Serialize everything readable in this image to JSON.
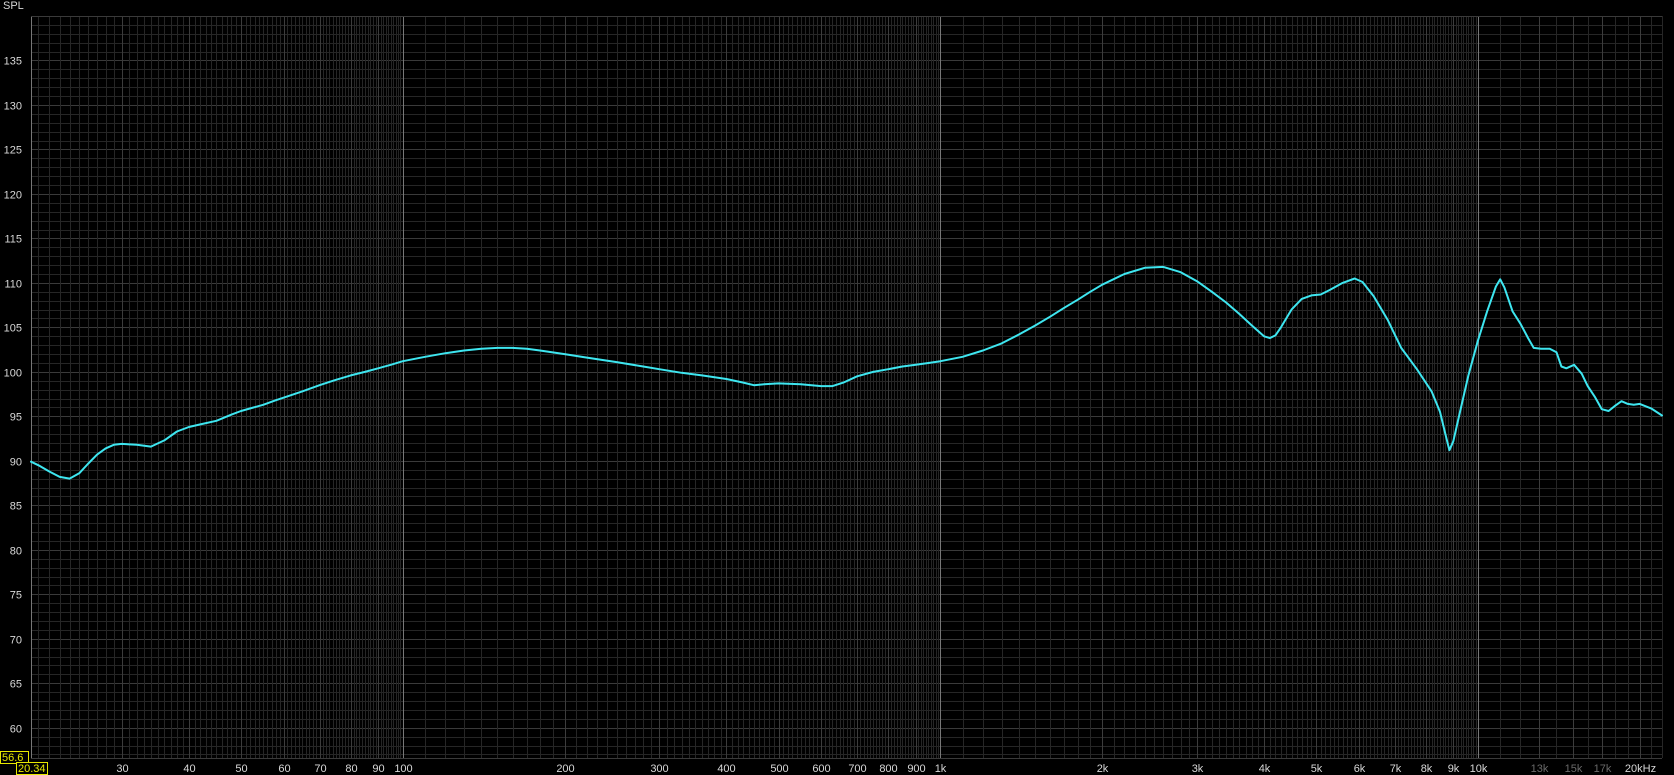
{
  "chart_data": {
    "type": "line",
    "title": "",
    "ylabel": "SPL",
    "xlabel": "",
    "x_scale": "log",
    "xlim": [
      20.34,
      22000
    ],
    "ylim": [
      56.6,
      140
    ],
    "y_ticks": [
      60,
      65,
      70,
      75,
      80,
      85,
      90,
      95,
      100,
      105,
      110,
      115,
      120,
      125,
      130,
      135
    ],
    "x_ticks": [
      {
        "value": 30,
        "label": "30"
      },
      {
        "value": 40,
        "label": "40"
      },
      {
        "value": 50,
        "label": "50"
      },
      {
        "value": 60,
        "label": "60"
      },
      {
        "value": 70,
        "label": "70"
      },
      {
        "value": 80,
        "label": "80"
      },
      {
        "value": 90,
        "label": "90"
      },
      {
        "value": 100,
        "label": "100"
      },
      {
        "value": 200,
        "label": "200"
      },
      {
        "value": 300,
        "label": "300"
      },
      {
        "value": 400,
        "label": "400"
      },
      {
        "value": 500,
        "label": "500"
      },
      {
        "value": 600,
        "label": "600"
      },
      {
        "value": 700,
        "label": "700"
      },
      {
        "value": 800,
        "label": "800"
      },
      {
        "value": 900,
        "label": "900"
      },
      {
        "value": 1000,
        "label": "1k"
      },
      {
        "value": 2000,
        "label": "2k"
      },
      {
        "value": 3000,
        "label": "3k"
      },
      {
        "value": 4000,
        "label": "4k"
      },
      {
        "value": 5000,
        "label": "5k"
      },
      {
        "value": 6000,
        "label": "6k"
      },
      {
        "value": 7000,
        "label": "7k"
      },
      {
        "value": 8000,
        "label": "8k"
      },
      {
        "value": 9000,
        "label": "9k"
      },
      {
        "value": 10000,
        "label": "10k"
      },
      {
        "value": 13000,
        "label": "13k",
        "dim": true
      },
      {
        "value": 15000,
        "label": "15k",
        "dim": true
      },
      {
        "value": 17000,
        "label": "17k",
        "dim": true
      },
      {
        "value": 20000,
        "label": "20kHz"
      }
    ],
    "x_min_label": "20.34",
    "y_min_label": "56.6",
    "grid": true,
    "colors": {
      "background": "#000000",
      "grid_minor": "#262626",
      "grid_major": "#777777",
      "series": "#3ee6f0",
      "readout": "#e8e800"
    },
    "series": [
      {
        "points": [
          [
            20.34,
            89.9
          ],
          [
            21,
            89.5
          ],
          [
            22,
            88.8
          ],
          [
            23,
            88.2
          ],
          [
            24,
            88.0
          ],
          [
            25,
            88.6
          ],
          [
            26,
            89.7
          ],
          [
            27,
            90.7
          ],
          [
            28,
            91.4
          ],
          [
            29,
            91.8
          ],
          [
            30,
            91.9
          ],
          [
            32,
            91.8
          ],
          [
            34,
            91.6
          ],
          [
            36,
            92.3
          ],
          [
            38,
            93.3
          ],
          [
            40,
            93.8
          ],
          [
            42,
            94.1
          ],
          [
            45,
            94.5
          ],
          [
            48,
            95.2
          ],
          [
            50,
            95.6
          ],
          [
            55,
            96.3
          ],
          [
            58,
            96.8
          ],
          [
            60,
            97.1
          ],
          [
            65,
            97.8
          ],
          [
            70,
            98.5
          ],
          [
            75,
            99.1
          ],
          [
            80,
            99.6
          ],
          [
            85,
            100.0
          ],
          [
            90,
            100.4
          ],
          [
            95,
            100.8
          ],
          [
            100,
            101.2
          ],
          [
            110,
            101.7
          ],
          [
            120,
            102.1
          ],
          [
            130,
            102.4
          ],
          [
            140,
            102.6
          ],
          [
            150,
            102.7
          ],
          [
            160,
            102.7
          ],
          [
            170,
            102.6
          ],
          [
            180,
            102.4
          ],
          [
            200,
            102.0
          ],
          [
            220,
            101.6
          ],
          [
            250,
            101.1
          ],
          [
            280,
            100.6
          ],
          [
            300,
            100.3
          ],
          [
            330,
            99.9
          ],
          [
            360,
            99.6
          ],
          [
            400,
            99.2
          ],
          [
            430,
            98.8
          ],
          [
            450,
            98.5
          ],
          [
            470,
            98.6
          ],
          [
            500,
            98.7
          ],
          [
            550,
            98.6
          ],
          [
            600,
            98.4
          ],
          [
            630,
            98.4
          ],
          [
            660,
            98.8
          ],
          [
            700,
            99.5
          ],
          [
            750,
            100.0
          ],
          [
            800,
            100.3
          ],
          [
            850,
            100.6
          ],
          [
            900,
            100.8
          ],
          [
            950,
            101.0
          ],
          [
            1000,
            101.2
          ],
          [
            1100,
            101.7
          ],
          [
            1200,
            102.4
          ],
          [
            1300,
            103.2
          ],
          [
            1400,
            104.2
          ],
          [
            1500,
            105.2
          ],
          [
            1600,
            106.2
          ],
          [
            1700,
            107.2
          ],
          [
            1800,
            108.1
          ],
          [
            1900,
            109.0
          ],
          [
            2000,
            109.8
          ],
          [
            2200,
            111.0
          ],
          [
            2400,
            111.7
          ],
          [
            2600,
            111.8
          ],
          [
            2800,
            111.2
          ],
          [
            3000,
            110.2
          ],
          [
            3200,
            109.0
          ],
          [
            3400,
            107.8
          ],
          [
            3600,
            106.5
          ],
          [
            3800,
            105.2
          ],
          [
            4000,
            104.0
          ],
          [
            4100,
            103.8
          ],
          [
            4200,
            104.1
          ],
          [
            4300,
            105.0
          ],
          [
            4500,
            107.0
          ],
          [
            4700,
            108.2
          ],
          [
            4900,
            108.6
          ],
          [
            5100,
            108.7
          ],
          [
            5300,
            109.2
          ],
          [
            5600,
            110.0
          ],
          [
            5900,
            110.5
          ],
          [
            6100,
            110.1
          ],
          [
            6400,
            108.5
          ],
          [
            6800,
            105.8
          ],
          [
            7200,
            102.7
          ],
          [
            7700,
            100.3
          ],
          [
            8200,
            97.8
          ],
          [
            8500,
            95.5
          ],
          [
            8700,
            93.0
          ],
          [
            8850,
            91.2
          ],
          [
            9000,
            92.2
          ],
          [
            9300,
            96.0
          ],
          [
            9600,
            99.6
          ],
          [
            10000,
            103.5
          ],
          [
            10400,
            106.8
          ],
          [
            10800,
            109.6
          ],
          [
            11000,
            110.4
          ],
          [
            11200,
            109.5
          ],
          [
            11600,
            106.8
          ],
          [
            12000,
            105.4
          ],
          [
            12400,
            103.8
          ],
          [
            12700,
            102.7
          ],
          [
            13100,
            102.6
          ],
          [
            13600,
            102.6
          ],
          [
            14000,
            102.2
          ],
          [
            14300,
            100.6
          ],
          [
            14600,
            100.4
          ],
          [
            15100,
            100.8
          ],
          [
            15600,
            99.8
          ],
          [
            16000,
            98.4
          ],
          [
            16500,
            97.2
          ],
          [
            17000,
            95.8
          ],
          [
            17500,
            95.6
          ],
          [
            18000,
            96.2
          ],
          [
            18500,
            96.7
          ],
          [
            19000,
            96.4
          ],
          [
            19500,
            96.3
          ],
          [
            20000,
            96.4
          ],
          [
            21000,
            95.9
          ],
          [
            22000,
            95.1
          ]
        ]
      }
    ]
  }
}
